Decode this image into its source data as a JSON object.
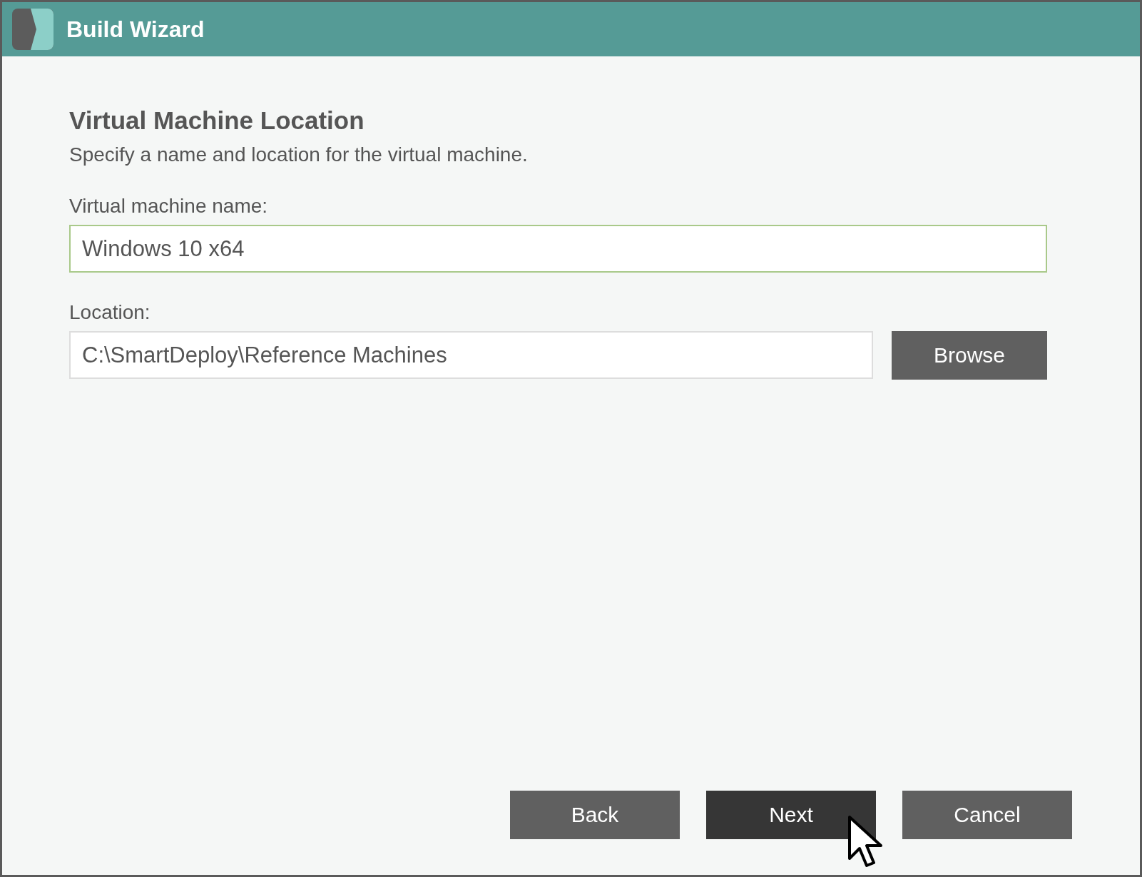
{
  "window": {
    "title": "Build Wizard"
  },
  "page": {
    "heading": "Virtual Machine Location",
    "description": "Specify a name and location for the virtual machine."
  },
  "fields": [
    {
      "label": "Virtual machine name:",
      "value": "Windows 10 x64",
      "focused": true
    },
    {
      "label": "Location:",
      "value": "C:\\SmartDeploy\\Reference Machines",
      "focused": false,
      "button": "Browse"
    }
  ],
  "buttons": [
    {
      "label": "Back",
      "hovered": false
    },
    {
      "label": "Next",
      "hovered": true
    },
    {
      "label": "Cancel",
      "hovered": false
    }
  ]
}
